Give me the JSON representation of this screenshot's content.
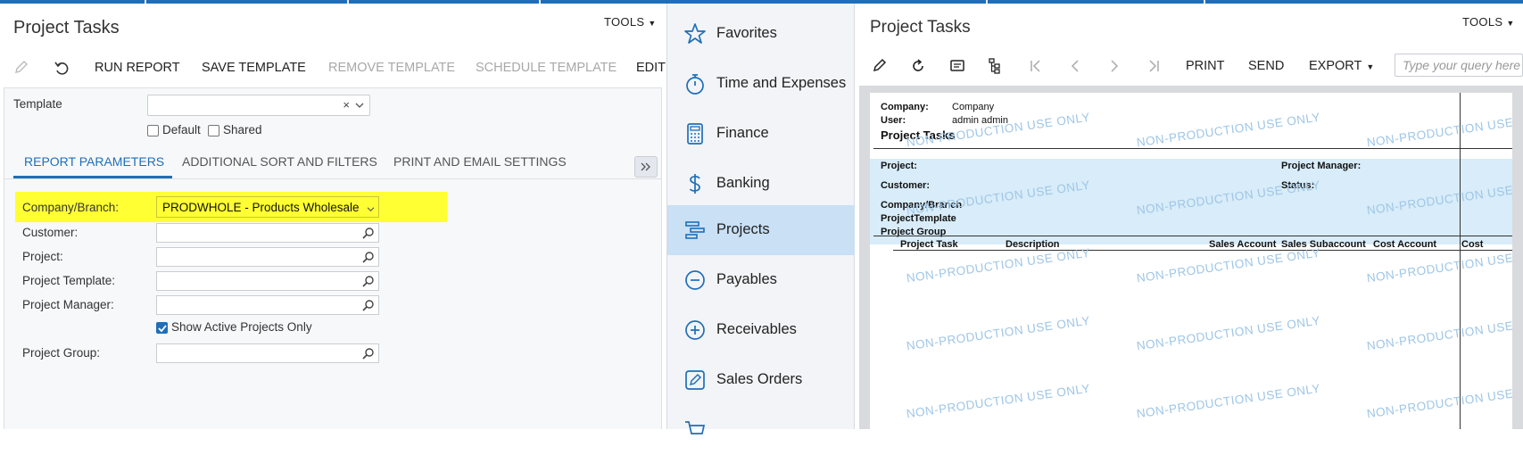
{
  "left": {
    "title": "Project Tasks",
    "tools_label": "TOOLS",
    "toolbar": {
      "run_report": "RUN REPORT",
      "save_template": "SAVE TEMPLATE",
      "remove_template": "REMOVE TEMPLATE",
      "schedule_template": "SCHEDULE TEMPLATE",
      "edit": "EDIT"
    },
    "template_label": "Template",
    "template_value": "",
    "default_label": "Default",
    "shared_label": "Shared",
    "tabs": {
      "report_parameters": "REPORT PARAMETERS",
      "additional_sort": "ADDITIONAL SORT AND FILTERS",
      "print_email": "PRINT AND EMAIL SETTINGS"
    },
    "params": {
      "company_branch_label": "Company/Branch:",
      "company_branch_value": "PRODWHOLE - Products Wholesale",
      "customer_label": "Customer:",
      "project_label": "Project:",
      "project_template_label": "Project Template:",
      "project_manager_label": "Project Manager:",
      "show_active_label": "Show Active Projects Only",
      "show_active_checked": true,
      "project_group_label": "Project Group:"
    }
  },
  "nav": {
    "items": [
      {
        "label": "Favorites",
        "icon": "star-icon"
      },
      {
        "label": "Time and Expenses",
        "icon": "stopwatch-icon"
      },
      {
        "label": "Finance",
        "icon": "calculator-icon"
      },
      {
        "label": "Banking",
        "icon": "dollar-icon"
      },
      {
        "label": "Projects",
        "icon": "gantt-icon"
      },
      {
        "label": "Payables",
        "icon": "minus-circle-icon"
      },
      {
        "label": "Receivables",
        "icon": "plus-circle-icon"
      },
      {
        "label": "Sales Orders",
        "icon": "edit-square-icon"
      }
    ],
    "active": "Projects"
  },
  "right": {
    "title": "Project Tasks",
    "tools_label": "TOOLS",
    "toolbar": {
      "print": "PRINT",
      "send": "SEND",
      "export": "EXPORT"
    },
    "query_placeholder": "Type your query here",
    "report": {
      "company_label": "Company:",
      "company_value": "Company",
      "user_label": "User:",
      "user_value": "admin admin",
      "title": "Project Tasks",
      "project_label": "Project:",
      "project_manager_label": "Project Manager:",
      "customer_label": "Customer:",
      "status_label": "Status:",
      "company_branch_label": "Company/Branch",
      "project_template_label": "ProjectTemplate",
      "project_group_label": "Project Group",
      "columns": [
        "Project Task",
        "Description",
        "Sales Account",
        "Sales Subaccount",
        "Cost Account",
        "Cost"
      ],
      "watermark": "NON-PRODUCTION USE ONLY"
    }
  },
  "colors": {
    "accent": "#1f6fb8",
    "highlight": "#ffff33",
    "nav_active": "#c9e0f5",
    "report_band": "#d8ecf9",
    "watermark": "#9fc6e6"
  }
}
